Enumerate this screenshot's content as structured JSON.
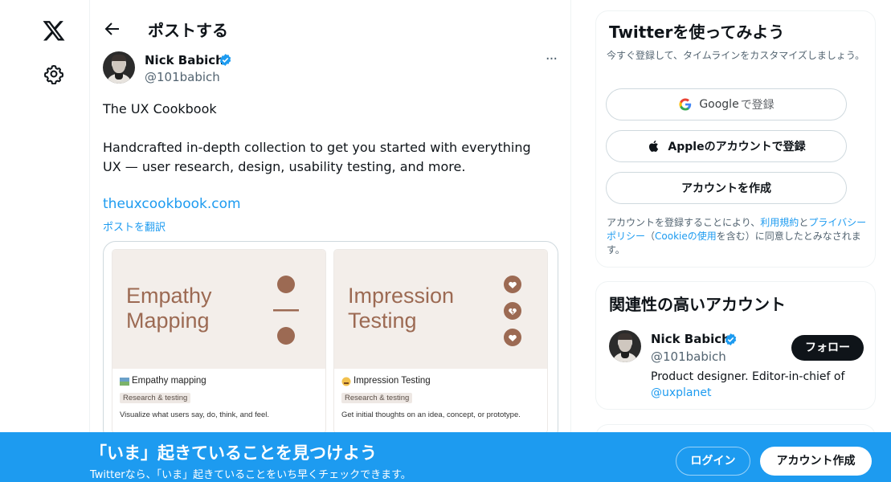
{
  "nav": {
    "logo_icon": "x-logo-icon",
    "settings_icon": "gear-icon"
  },
  "header": {
    "title": "ポストする",
    "back_icon": "arrow-left-icon"
  },
  "post": {
    "author_name": "Nick Babich",
    "author_handle": "@101babich",
    "more_label": "···",
    "text_line1": "The UX Cookbook",
    "text_line2": "Handcrafted in-depth collection to get you started with everything UX — user research, design, usability testing, and more.",
    "link": "theuxcookbook.com",
    "translate": "ポストを翻訳",
    "cards": [
      {
        "art_title_1": "Empathy",
        "art_title_2": "Mapping",
        "title": "Empathy mapping",
        "tag": "Research & testing",
        "desc": "Visualize what users say, do, think, and feel.",
        "emoji_icon": "map-emoji-icon"
      },
      {
        "art_title_1": "Impression",
        "art_title_2": "Testing",
        "title": "Impression Testing",
        "tag": "Research & testing",
        "desc": "Get initial thoughts on an idea, concept, or prototype.",
        "emoji_icon": "shaking-face-emoji-icon"
      }
    ]
  },
  "signup": {
    "title": "Twitterを使ってみよう",
    "subtitle": "今すぐ登録して、タイムラインをカスタマイズしましょう。",
    "google_label": "Google",
    "google_suffix": "で登録",
    "apple_label": "Appleのアカウントで登録",
    "create_label": "アカウントを作成",
    "terms_1": "アカウントを登録することにより、",
    "terms_link_1": "利用規約",
    "terms_2": "と",
    "terms_link_2": "プライバシーポリシー",
    "terms_3": "（",
    "terms_link_3": "Cookieの使用",
    "terms_4": "を含む）に同意したとみなされます。"
  },
  "related": {
    "title": "関連性の高いアカウント",
    "name": "Nick Babich",
    "handle": "@101babich",
    "follow_label": "フォロー",
    "bio": "Product designer. Editor-in-chief of ",
    "bio_link": "@uxplanet"
  },
  "banner": {
    "title": "「いま」起きていることを見つけよう",
    "subtitle": "Twitterなら、「いま」起きていることをいち早くチェックできます。",
    "login_label": "ログイン",
    "signup_label": "アカウント作成"
  },
  "colors": {
    "accent": "#1d9bf0",
    "card_art": "#f3eeea",
    "card_text": "#9c6a53",
    "dark": "#0f1419"
  }
}
